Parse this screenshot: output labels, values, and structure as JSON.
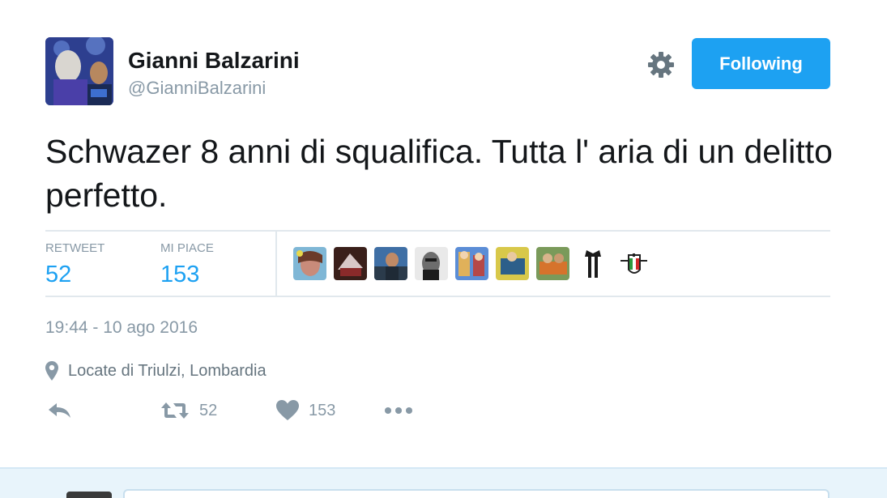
{
  "author": {
    "name": "Gianni Balzarini",
    "handle": "@GianniBalzarini"
  },
  "follow_button": {
    "label": "Following"
  },
  "tweet": {
    "text": "Schwazer 8 anni di squalifica. Tutta l' aria di un delitto perfetto."
  },
  "stats": {
    "retweet_label": "RETWEET",
    "retweet_count": "52",
    "like_label": "MI PIACE",
    "like_count": "153"
  },
  "timestamp": "19:44 - 10 ago 2016",
  "location": "Locate di Triulzi, Lombardia",
  "actions": {
    "retweet_count": "52",
    "like_count": "153"
  },
  "icons": {
    "settings": "gear-icon",
    "location": "map-pin-icon",
    "reply": "reply-icon",
    "retweet": "retweet-icon",
    "like": "heart-icon",
    "more": "more-dots-icon"
  },
  "colors": {
    "accent": "#1da1f2",
    "text": "#14171a",
    "muted": "#8899a6",
    "divider": "#e1e8ed"
  }
}
